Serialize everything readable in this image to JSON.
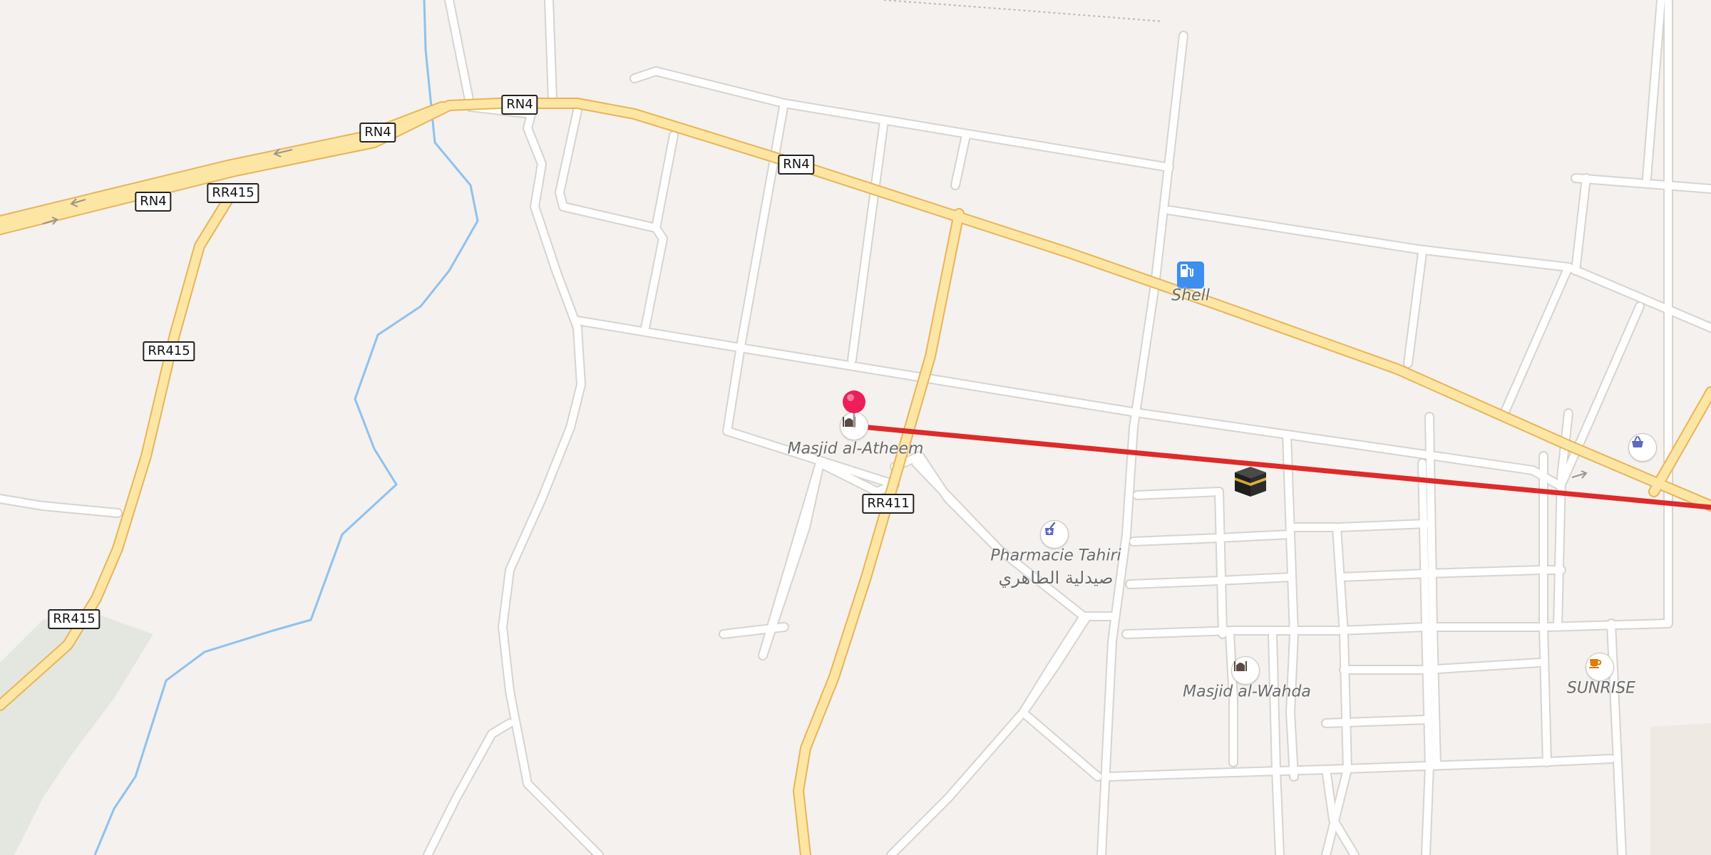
{
  "colors": {
    "land": "#f4f1ee",
    "block": "#f7f4f1",
    "street_fill": "#ffffff",
    "street_casing": "#d8d3cd",
    "major_road_fill": "#fde6a3",
    "major_road_casing": "#e8b45a",
    "river": "#8fc1ee",
    "route_line": "#de2a2a",
    "pin": "#ec1f5b",
    "fuel_badge": "#3e8ef0"
  },
  "road_shields": [
    {
      "id": "rn4-a",
      "text": "RN4"
    },
    {
      "id": "rn4-b",
      "text": "RN4"
    },
    {
      "id": "rn4-c",
      "text": "RN4"
    },
    {
      "id": "rn4-d",
      "text": "RN4"
    },
    {
      "id": "rr415-a",
      "text": "RR415"
    },
    {
      "id": "rr415-b",
      "text": "RR415"
    },
    {
      "id": "rr415-c",
      "text": "RR415"
    },
    {
      "id": "rr411",
      "text": "RR411"
    }
  ],
  "pois": {
    "shell": {
      "name": "Shell",
      "icon": "fuel-pump-icon"
    },
    "masjid_atheem": {
      "name": "Masjid al-Atheem",
      "icon": "mosque-icon"
    },
    "pharmacie": {
      "name": "Pharmacie Tahiri",
      "name_ar": "صيدلية الطاهري",
      "icon": "pharmacy-icon"
    },
    "masjid_wahda": {
      "name": "Masjid al-Wahda",
      "icon": "mosque-icon"
    },
    "sunrise": {
      "name": "SUNRISE",
      "icon": "coffee-cup-icon"
    },
    "shop": {
      "icon": "shopping-basket-icon"
    }
  },
  "markers": {
    "location_pin": "map-pin-icon",
    "qibla_target": "kaaba-icon"
  }
}
